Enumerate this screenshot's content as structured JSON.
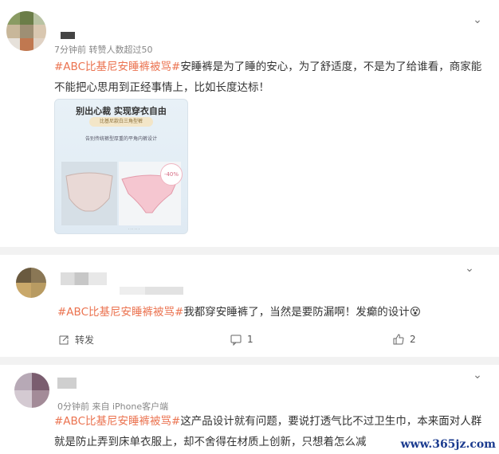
{
  "posts": [
    {
      "meta": "7分钟前  转赞人数超过50",
      "hashtag": "#ABC比基尼安睡裤被骂#",
      "body": "安睡裤是为了睡的安心，为了舒适度，不是为了给谁看，商家能不能把心思用到正经事情上，比如长度达标！",
      "image": {
        "headline": "别出心裁  实现穿衣自由",
        "pill": "比基尼款白三角型裤",
        "sub": "告别传统裤型厚重的平角内裤设计",
        "badge": "-40%"
      }
    },
    {
      "hashtag": "#ABC比基尼安睡裤被骂#",
      "body": "我都穿安睡裤了，当然是要防漏啊！发癫的设计",
      "emoji": "😵",
      "actions": {
        "share": "转发",
        "comments": "1",
        "likes": "2"
      }
    },
    {
      "meta": "0分钟前  来自 iPhone客户端",
      "hashtag": "#ABC比基尼安睡裤被骂#",
      "body": "这产品设计就有问题，要说打透气比不过卫生巾，本来面对人群就是防止弄到床单衣服上，却不舍得在材质上创新，只想着怎么减"
    }
  ],
  "watermark": "www.365jz.com",
  "colors": {
    "hashtag": "#eb7350",
    "divider": "#f2f2f2"
  }
}
